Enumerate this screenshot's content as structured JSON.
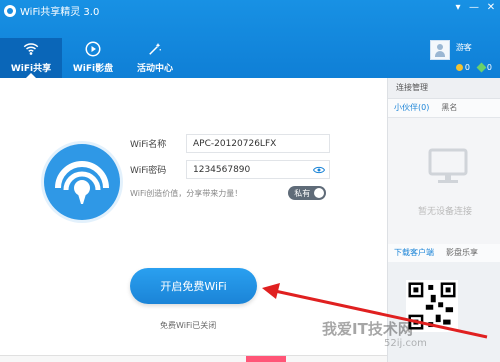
{
  "window": {
    "title": "WiFi共享精灵 3.0",
    "controls": [
      "▾",
      "—",
      "✕"
    ]
  },
  "nav": [
    {
      "label": "WiFi共享",
      "icon": "wifi-icon",
      "active": true
    },
    {
      "label": "WiFi影盘",
      "icon": "play-icon",
      "active": false
    },
    {
      "label": "活动中心",
      "icon": "magic-wand-icon",
      "active": false
    }
  ],
  "user": {
    "name": "游客",
    "coins": "0",
    "gems": "0"
  },
  "share": {
    "name_label": "WiFi名称",
    "name_value": "APC-20120726LFX",
    "password_label": "WiFi密码",
    "password_value": "1234567890",
    "hint": "WiFi创造价值，分享带来力量！",
    "privacy_label": "私有"
  },
  "start_button": "开启免费WiFi",
  "status": "免费WiFi已关闭",
  "side": {
    "header": "连接管理",
    "tabs": [
      "小伙伴(0)",
      "黑名"
    ],
    "empty_text": "暂无设备连接",
    "promo_tabs": [
      "下载客户端",
      "影盘乐享"
    ]
  },
  "watermark": {
    "text": "我爱IT技术网",
    "sub": "52ij.com"
  },
  "colors": {
    "brand": "#1a8de0",
    "arrow": "#e02020"
  }
}
